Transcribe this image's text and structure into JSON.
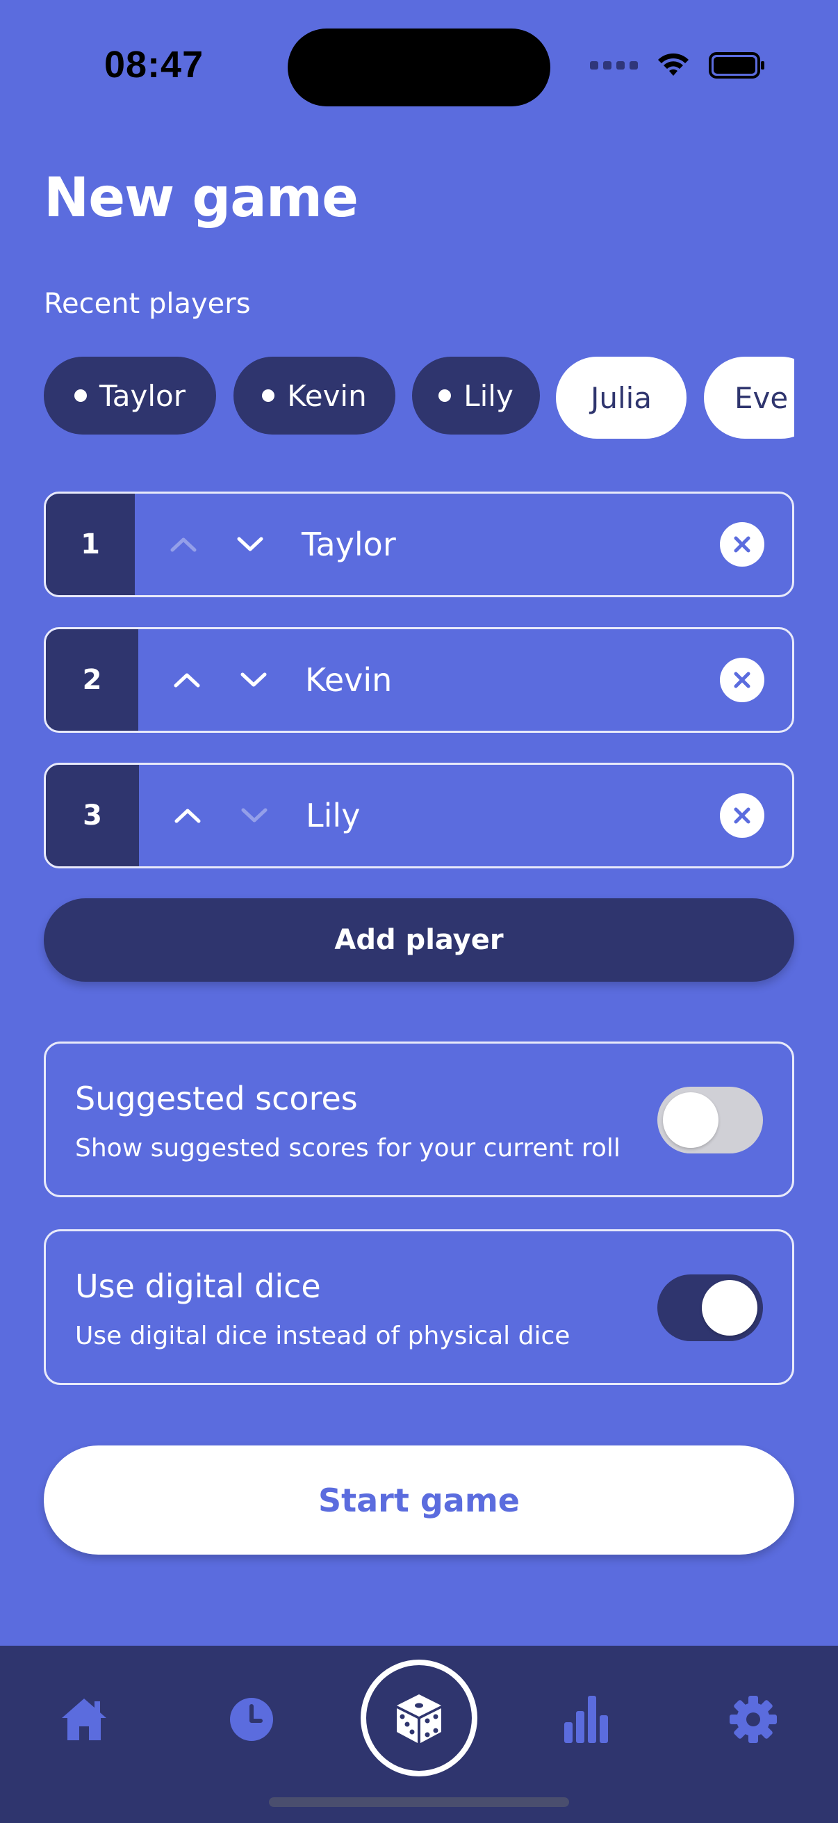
{
  "status_bar": {
    "time": "08:47"
  },
  "page": {
    "title": "New game",
    "recent_label": "Recent players"
  },
  "recent_players": [
    {
      "name": "Taylor",
      "selected": true
    },
    {
      "name": "Kevin",
      "selected": true
    },
    {
      "name": "Lily",
      "selected": true
    },
    {
      "name": "Julia",
      "selected": false
    },
    {
      "name": "Eve",
      "selected": false
    }
  ],
  "players": [
    {
      "number": "1",
      "name": "Taylor",
      "up_enabled": false,
      "down_enabled": true
    },
    {
      "number": "2",
      "name": "Kevin",
      "up_enabled": true,
      "down_enabled": true
    },
    {
      "number": "3",
      "name": "Lily",
      "up_enabled": true,
      "down_enabled": false
    }
  ],
  "add_player_label": "Add player",
  "settings": {
    "suggested": {
      "title": "Suggested scores",
      "desc": "Show suggested scores for your current roll",
      "enabled": false
    },
    "digital_dice": {
      "title": "Use digital dice",
      "desc": "Use digital dice instead of physical dice",
      "enabled": true
    }
  },
  "start_label": "Start game",
  "nav": {
    "items": [
      "home-icon",
      "history-icon",
      "dice-icon",
      "stats-icon",
      "settings-icon"
    ]
  },
  "colors": {
    "background": "#5B6CDE",
    "dark": "#2F356E",
    "white": "#FFFFFF"
  }
}
